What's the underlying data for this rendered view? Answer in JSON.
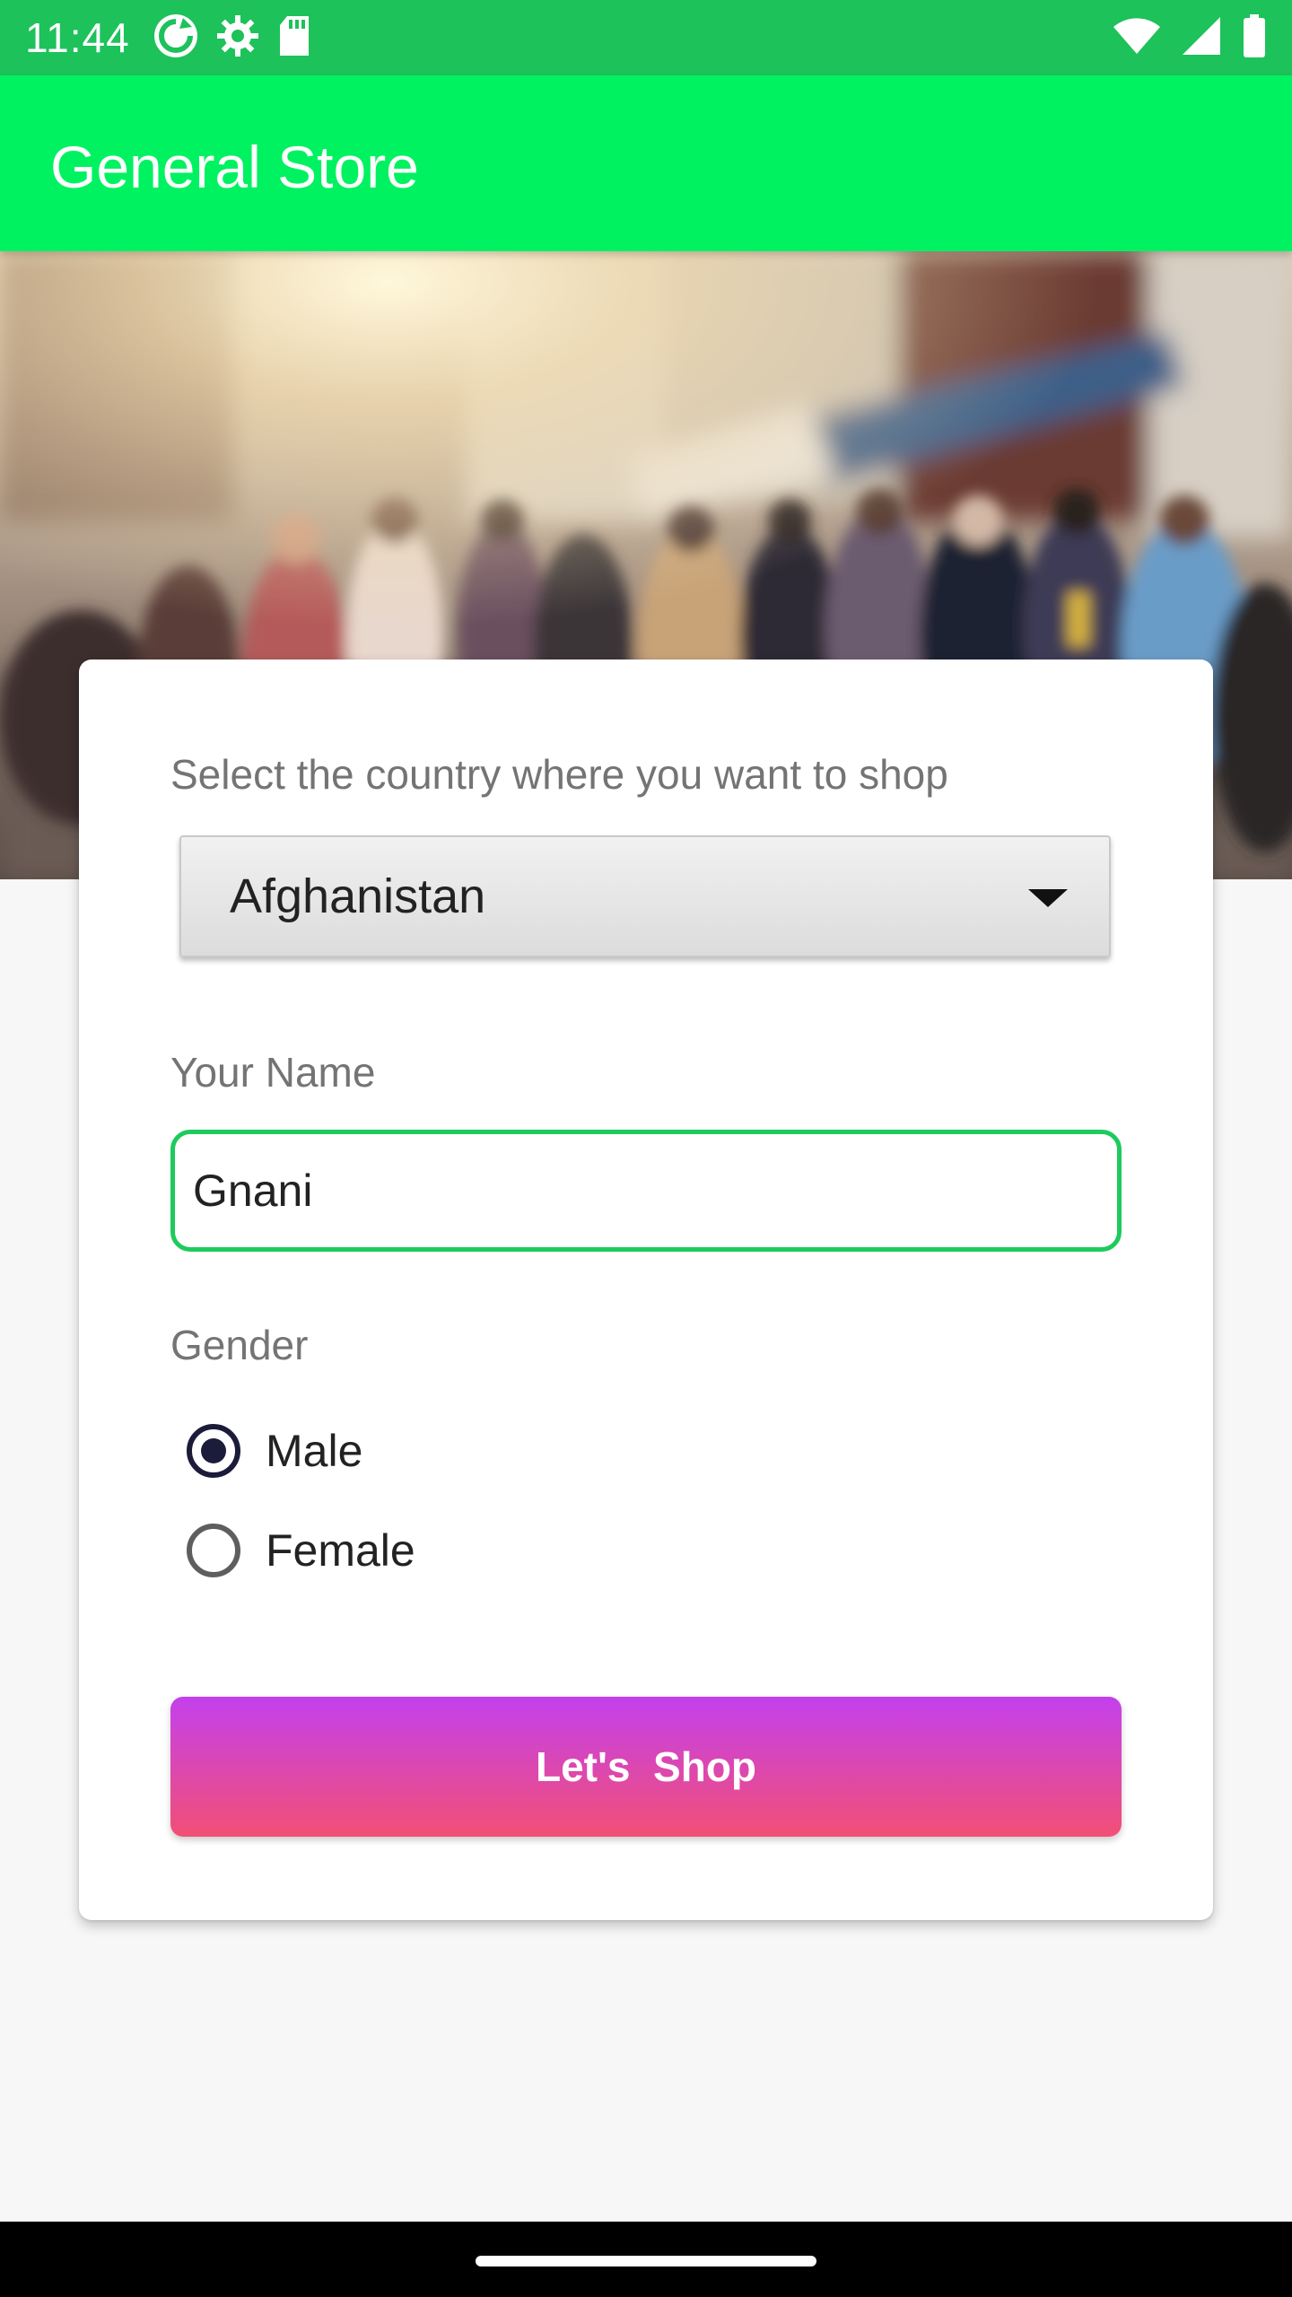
{
  "status_bar": {
    "time": "11:44",
    "left_icons": [
      "sync-icon",
      "gear-icon",
      "sd-card-icon"
    ],
    "right_icons": [
      "wifi-icon",
      "signal-icon",
      "battery-icon"
    ],
    "color": "#1dc25a"
  },
  "app_bar": {
    "title": "General Store",
    "color": "#00f261"
  },
  "hero": {
    "image": "blurred-shopping-street-crowd"
  },
  "form": {
    "country_label": "Select the country where you want to shop",
    "country_selected": "Afghanistan",
    "name_label": "Your Name",
    "name_value": "Gnani",
    "gender_label": "Gender",
    "gender_options": [
      "Male",
      "Female"
    ],
    "gender_selected": "Male",
    "submit_label": "Let's  Shop",
    "accent_color": "#1dcb5c",
    "button_gradient": [
      "#c440ed",
      "#f24f75"
    ]
  }
}
